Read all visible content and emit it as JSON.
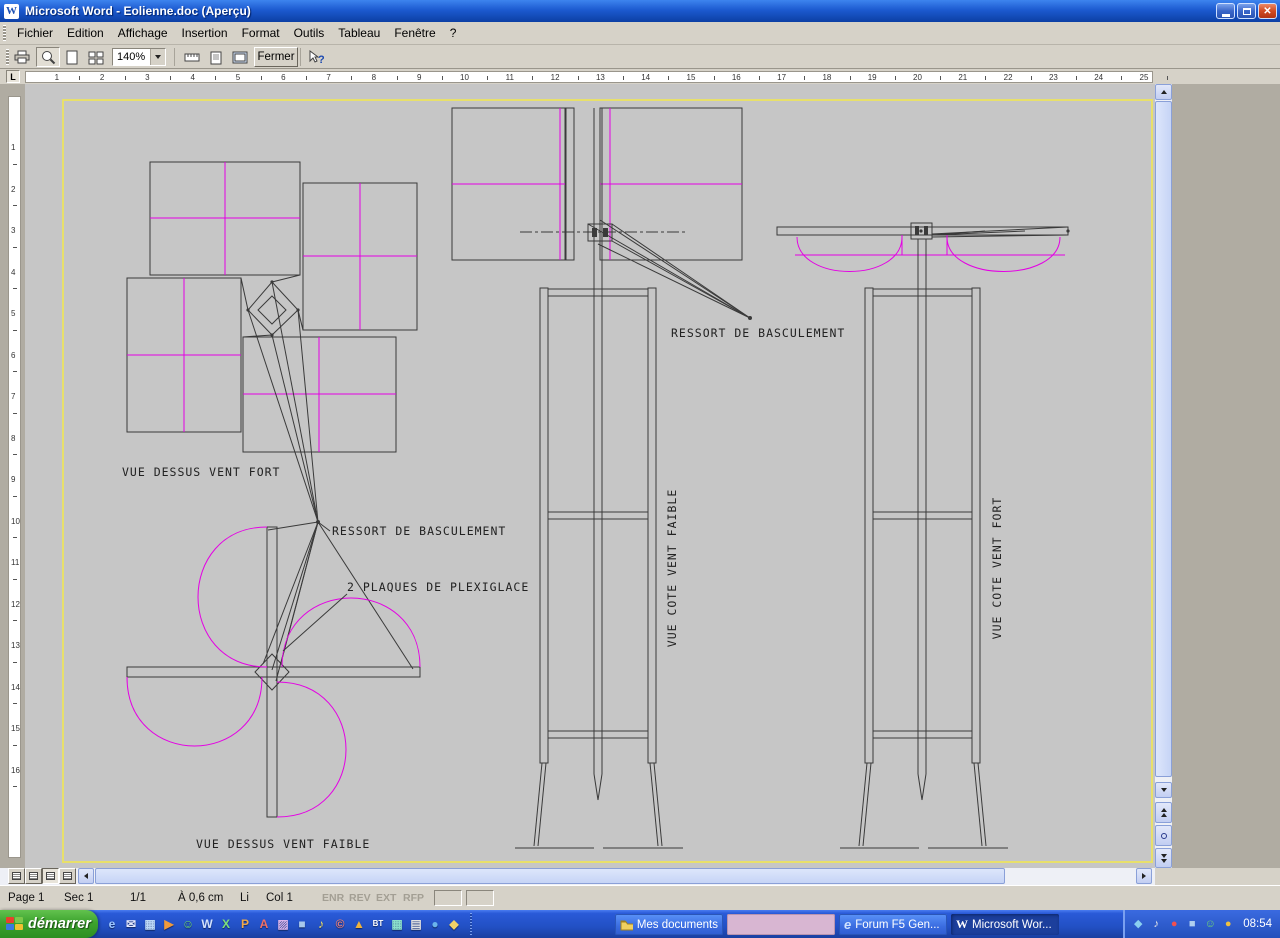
{
  "window": {
    "title": "Microsoft Word - Eolienne.doc (Aperçu)",
    "icon_letter": "W"
  },
  "titlebar": {
    "close_glyph": "✕"
  },
  "menu": {
    "items": [
      "Fichier",
      "Edition",
      "Affichage",
      "Insertion",
      "Format",
      "Outils",
      "Tableau",
      "Fenêtre",
      "?"
    ]
  },
  "toolbar": {
    "zoom": "140%",
    "close": "Fermer",
    "help_glyph": "?"
  },
  "rulers": {
    "tab_selector": "L",
    "horizontal": [
      "1",
      "2",
      "3",
      "4",
      "5",
      "6",
      "7",
      "8",
      "9",
      "10",
      "11",
      "12",
      "13",
      "14",
      "15",
      "16",
      "17",
      "18",
      "19",
      "20",
      "21",
      "22",
      "23",
      "24",
      "25"
    ],
    "vertical": [
      "1",
      "2",
      "3",
      "4",
      "5",
      "6",
      "7",
      "8",
      "9",
      "10",
      "11",
      "12",
      "13",
      "14",
      "15",
      "16"
    ]
  },
  "drawing": {
    "labels": {
      "vue_dessus_vent_fort": "VUE DESSUS VENT FORT",
      "ressort_left": "RESSORT DE BASCULEMENT",
      "plaques": "2 PLAQUES DE PLEXIGLACE",
      "vue_dessus_vent_faible": "VUE DESSUS VENT FAIBLE",
      "ressort_mid": "RESSORT DE BASCULEMENT",
      "vue_cote_vent_faible": "VUE COTE VENT FAIBLE",
      "vue_cote_vent_fort": "VUE COTE VENT FORT"
    },
    "colors": {
      "line": "#3a3a3a",
      "magenta": "#e400e4",
      "border": "#e8e06a",
      "page": "#c6c6c6"
    }
  },
  "statusbar": {
    "page": "Page 1",
    "section": "Sec 1",
    "of": "1/1",
    "at": "À 0,6 cm",
    "line": "Li",
    "col": "Col 1",
    "flags": [
      "ENR",
      "REV",
      "EXT",
      "RFP"
    ]
  },
  "taskbar": {
    "start": "démarrer",
    "clock": "08:54",
    "quicklaunch": [
      {
        "name": "internet-explorer-icon",
        "glyph": "e",
        "color": "#9cc6ff"
      },
      {
        "name": "outlook-express-icon",
        "glyph": "✉",
        "color": "#e8ecff"
      },
      {
        "name": "show-desktop-icon",
        "glyph": "▦",
        "color": "#bcd8f8"
      },
      {
        "name": "media-player-icon",
        "glyph": "▶",
        "color": "#f09a3c"
      },
      {
        "name": "messenger-icon",
        "glyph": "☺",
        "color": "#6ad86a"
      },
      {
        "name": "word-icon",
        "glyph": "W",
        "color": "#d2e2ff"
      },
      {
        "name": "excel-icon",
        "glyph": "X",
        "color": "#7ce07c"
      },
      {
        "name": "powerpoint-icon",
        "glyph": "P",
        "color": "#f0a848"
      },
      {
        "name": "access-icon",
        "glyph": "A",
        "color": "#f07068"
      },
      {
        "name": "paint-icon",
        "glyph": "▨",
        "color": "#d8b4ec"
      },
      {
        "name": "calculator-icon",
        "glyph": "■",
        "color": "#a8c8ec"
      },
      {
        "name": "music-player-icon",
        "glyph": "♪",
        "color": "#f0e26a"
      },
      {
        "name": "copyright-tool-icon",
        "glyph": "©",
        "color": "#f08078"
      },
      {
        "name": "warning-tool-icon",
        "glyph": "▲",
        "color": "#f0b23c"
      },
      {
        "name": "bt-icon",
        "glyph": "BT",
        "color": "#ffffff"
      },
      {
        "name": "grid-tool-icon",
        "glyph": "▦",
        "color": "#8ce0cc"
      },
      {
        "name": "document-icon",
        "glyph": "▤",
        "color": "#e4e4e4"
      },
      {
        "name": "globe-icon",
        "glyph": "●",
        "color": "#6ab4ec"
      },
      {
        "name": "folder-tool-icon",
        "glyph": "◆",
        "color": "#f0d268"
      }
    ],
    "tasks": [
      {
        "label": "Mes documents"
      },
      {
        "label": ""
      },
      {
        "label": "Forum F5 Gen...",
        "icon_glyph": "e"
      },
      {
        "label": "Microsoft Wor...",
        "icon_glyph": "W"
      }
    ],
    "tray": [
      {
        "name": "graphics-tray-icon",
        "glyph": "◆",
        "color": "#8ad0f0"
      },
      {
        "name": "volume-icon",
        "glyph": "♪",
        "color": "#e8e8e8"
      },
      {
        "name": "antivirus-tray-icon",
        "glyph": "●",
        "color": "#f05050"
      },
      {
        "name": "network-tray-icon",
        "glyph": "■",
        "color": "#b0d0f0"
      },
      {
        "name": "messenger-tray-icon",
        "glyph": "☺",
        "color": "#70d870"
      },
      {
        "name": "update-tray-icon",
        "glyph": "●",
        "color": "#f0c040"
      }
    ]
  }
}
